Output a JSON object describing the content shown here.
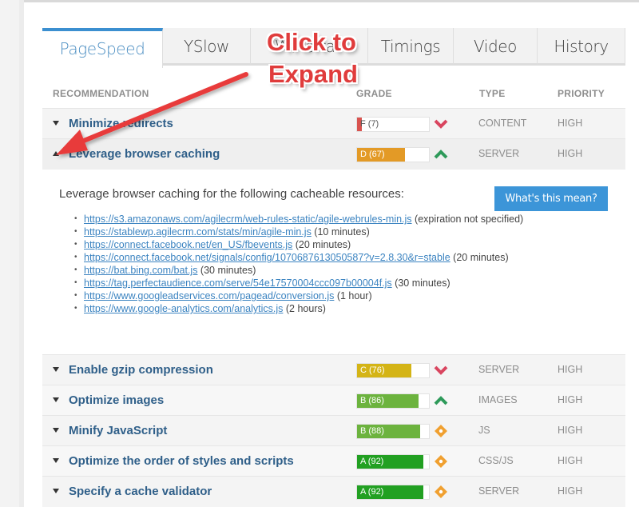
{
  "tabs": [
    {
      "label": "PageSpeed",
      "active": true
    },
    {
      "label": "YSlow",
      "active": false
    },
    {
      "label": "Waterfall",
      "active": false
    },
    {
      "label": "Timings",
      "active": false
    },
    {
      "label": "Video",
      "active": false
    },
    {
      "label": "History",
      "active": false
    }
  ],
  "table_headers": {
    "recommendation": "RECOMMENDATION",
    "grade": "GRADE",
    "type": "TYPE",
    "priority": "PRIORITY"
  },
  "rows": [
    {
      "name": "Minimize redirects",
      "grade_label": "F (7)",
      "score_percent": 7,
      "color": "#d9534f",
      "trend": "down",
      "type": "CONTENT",
      "priority": "HIGH",
      "expanded": false
    },
    {
      "name": "Leverage browser caching",
      "grade_label": "D (67)",
      "score_percent": 67,
      "color": "#e39a26",
      "trend": "up",
      "type": "SERVER",
      "priority": "HIGH",
      "expanded": true
    },
    {
      "name": "Enable gzip compression",
      "grade_label": "C (76)",
      "score_percent": 76,
      "color": "#d4b416",
      "trend": "down",
      "type": "SERVER",
      "priority": "HIGH",
      "expanded": false
    },
    {
      "name": "Optimize images",
      "grade_label": "B (86)",
      "score_percent": 86,
      "color": "#6cb33e",
      "trend": "up",
      "type": "IMAGES",
      "priority": "HIGH",
      "expanded": false
    },
    {
      "name": "Minify JavaScript",
      "grade_label": "B (88)",
      "score_percent": 88,
      "color": "#6cb33e",
      "trend": "neutral",
      "type": "JS",
      "priority": "HIGH",
      "expanded": false
    },
    {
      "name": "Optimize the order of styles and scripts",
      "grade_label": "A (92)",
      "score_percent": 92,
      "color": "#22a022",
      "trend": "neutral",
      "type": "CSS/JS",
      "priority": "HIGH",
      "expanded": false
    },
    {
      "name": "Specify a cache validator",
      "grade_label": "A (92)",
      "score_percent": 92,
      "color": "#22a022",
      "trend": "neutral",
      "type": "SERVER",
      "priority": "HIGH",
      "expanded": false
    }
  ],
  "detail": {
    "intro": "Leverage browser caching for the following cacheable resources:",
    "button_label": "What's this mean?",
    "resources": [
      {
        "url": "https://s3.amazonaws.com/agilecrm/web-rules-static/agile-webrules-min.js",
        "note": " (expiration not specified)"
      },
      {
        "url": "https://stablewp.agilecrm.com/stats/min/agile-min.js",
        "note": " (10 minutes)"
      },
      {
        "url": "https://connect.facebook.net/en_US/fbevents.js",
        "note": " (20 minutes)"
      },
      {
        "url": "https://connect.facebook.net/signals/config/1070687613050587?v=2.8.30&r=stable",
        "note": " (20 minutes)"
      },
      {
        "url": "https://bat.bing.com/bat.js",
        "note": " (30 minutes)"
      },
      {
        "url": "https://tag.perfectaudience.com/serve/54e17570004ccc097b00004f.js",
        "note": " (30 minutes)"
      },
      {
        "url": "https://www.googleadservices.com/pagead/conversion.js",
        "note": " (1 hour)"
      },
      {
        "url": "https://www.google-analytics.com/analytics.js",
        "note": " (2 hours)"
      }
    ]
  },
  "annotation": {
    "line1": "Click to",
    "line2": "Expand",
    "color": "#e03c3c"
  },
  "colors": {
    "accent": "#3b8fd0",
    "link": "#3c84c1",
    "trend_down": "#d9455f",
    "trend_up": "#2e9a5a",
    "trend_neutral": "#f0a030"
  }
}
